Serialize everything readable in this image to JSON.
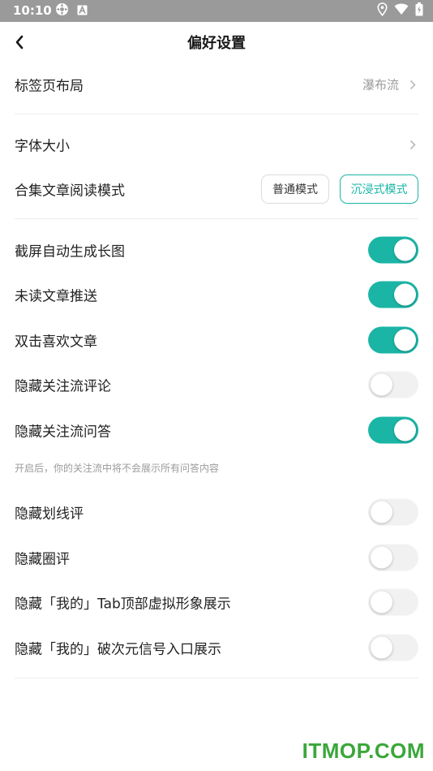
{
  "status_bar": {
    "time": "10:10",
    "left_icons": [
      "settings-wheel-icon",
      "a-square-icon"
    ],
    "right_icons": [
      "location-icon",
      "wifi-icon",
      "battery-icon"
    ]
  },
  "header": {
    "title": "偏好设置",
    "back_icon": "chevron-left-icon"
  },
  "rows": {
    "tab_layout": {
      "label": "标签页布局",
      "value": "瀑布流"
    },
    "font_size": {
      "label": "字体大小"
    },
    "collection_reading_mode": {
      "label": "合集文章阅读模式",
      "options": [
        "普通模式",
        "沉浸式模式"
      ],
      "selected": "沉浸式模式"
    },
    "screenshot_long_image": {
      "label": "截屏自动生成长图",
      "on": true
    },
    "unread_push": {
      "label": "未读文章推送",
      "on": true
    },
    "double_tap_like": {
      "label": "双击喜欢文章",
      "on": true
    },
    "hide_follow_comments": {
      "label": "隐藏关注流评论",
      "on": false
    },
    "hide_follow_qa": {
      "label": "隐藏关注流问答",
      "on": true
    },
    "hide_follow_qa_hint": "开启后，你的关注流中将不会展示所有问答内容",
    "hide_underline_comments": {
      "label": "隐藏划线评",
      "on": false
    },
    "hide_circle_comments": {
      "label": "隐藏圈评",
      "on": false
    },
    "hide_tab_avatar": {
      "label": "隐藏「我的」Tab顶部虚拟形象展示",
      "on": false
    },
    "hide_ciyuan_entry": {
      "label": "隐藏「我的」破次元信号入口展示",
      "on": false
    }
  },
  "watermark": "ITMOP.COM",
  "colors": {
    "accent": "#1bb5a6",
    "status_bar": "#9a9a9a",
    "toggle_off": "#f1f1f1",
    "watermark": "#3aa73a"
  }
}
